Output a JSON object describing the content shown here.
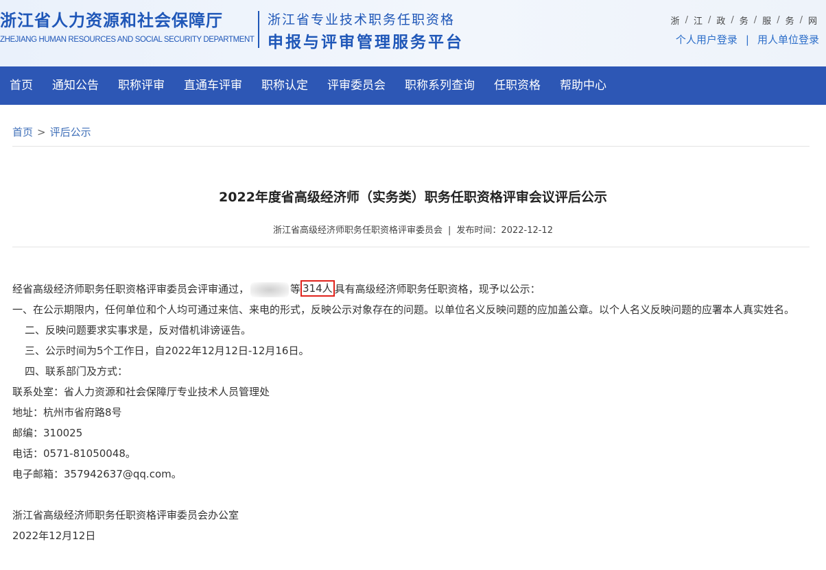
{
  "header": {
    "logo_cn": "浙江省人力资源和社会保障厅",
    "logo_en": "ZHEJIANG HUMAN RESOURCES AND SOCIAL SECURITY DEPARTMENT",
    "platform_sub": "浙江省专业技术职务任职资格",
    "platform_main": "申报与评审管理服务平台",
    "gov_link_chars": [
      "浙",
      "江",
      "政",
      "务",
      "服",
      "务",
      "网"
    ],
    "personal_login": "个人用户登录",
    "separator": "|",
    "unit_login": "用人单位登录"
  },
  "nav": {
    "items": [
      "首页",
      "通知公告",
      "职称评审",
      "直通车评审",
      "职称认定",
      "评审委员会",
      "职称系列查询",
      "任职资格",
      "帮助中心"
    ]
  },
  "breadcrumb": {
    "home": "首页",
    "separator": ">",
    "current": "评后公示"
  },
  "article": {
    "title": "2022年度省高级经济师（实务类）职务任职资格评审会议评后公示",
    "publisher": "浙江省高级经济师职务任职资格评审委员会",
    "meta_separator": "|",
    "publish_label": "发布时间：2022-12-12",
    "intro_before": "经省高级经济师职务任职资格评审委员会评审通过，",
    "intro_deng": "等",
    "intro_count": "314人",
    "intro_after": "具有高级经济师职务任职资格，现予以公示：",
    "item1": "一、在公示期限内，任何单位和个人均可通过来信、来电的形式，反映公示对象存在的问题。以单位名义反映问题的应加盖公章。以个人名义反映问题的应署本人真实姓名。",
    "item2": "二、反映问题要求实事求是，反对借机诽谤诬告。",
    "item3": "三、公示时间为5个工作日，自2022年12月12日-12月16日。",
    "item4": "四、联系部门及方式：",
    "contact_office": "联系处室：省人力资源和社会保障厅专业技术人员管理处",
    "address": "地址：杭州市省府路8号",
    "postcode": "邮编：310025",
    "phone": "电话：0571-81050048。",
    "email": "电子邮箱：357942637@qq.com。",
    "signature": "浙江省高级经济师职务任职资格评审委员会办公室",
    "date": "2022年12月12日"
  },
  "colors": {
    "brand_blue": "#1f57b8",
    "nav_bg": "#2d57b5",
    "link_blue": "#3f6fb8",
    "highlight_red": "#e0221b"
  }
}
